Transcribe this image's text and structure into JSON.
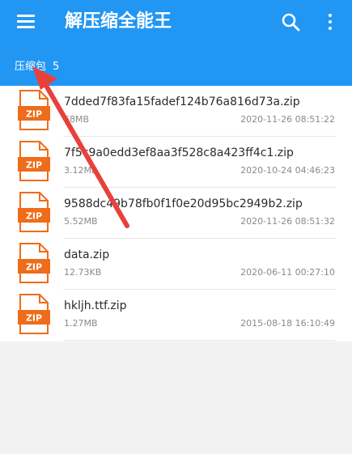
{
  "appbar": {
    "title": "解压缩全能王",
    "menu_icon": "menu-icon",
    "search_icon": "search-icon",
    "more_icon": "more-vert-icon",
    "color": "#2196f3"
  },
  "breadcrumb": {
    "label": "压缩包",
    "count": "5"
  },
  "files": [
    {
      "name": "7dded7f83fa15fadef124b76a816d73a.zip",
      "size": "68MB",
      "date": "2020-11-26 08:51:22",
      "icon": "zip-file-icon",
      "badge": "ZIP"
    },
    {
      "name": "7f5c9a0edd3ef8aa3f528c8a423ff4c1.zip",
      "size": "3.12MB",
      "date": "2020-10-24 04:46:23",
      "icon": "zip-file-icon",
      "badge": "ZIP"
    },
    {
      "name": "9588dc49b78fb0f1f0e20d95bc2949b2.zip",
      "size": "5.52MB",
      "date": "2020-11-26 08:51:32",
      "icon": "zip-file-icon",
      "badge": "ZIP"
    },
    {
      "name": "data.zip",
      "size": "12.73KB",
      "date": "2020-06-11 00:27:10",
      "icon": "zip-file-icon",
      "badge": "ZIP"
    },
    {
      "name": "hkljh.ttf.zip",
      "size": "1.27MB",
      "date": "2015-08-18 16:10:49",
      "icon": "zip-file-icon",
      "badge": "ZIP"
    }
  ],
  "colors": {
    "zip_orange": "#ef6c1a",
    "annotation_arrow": "#e8413b"
  }
}
